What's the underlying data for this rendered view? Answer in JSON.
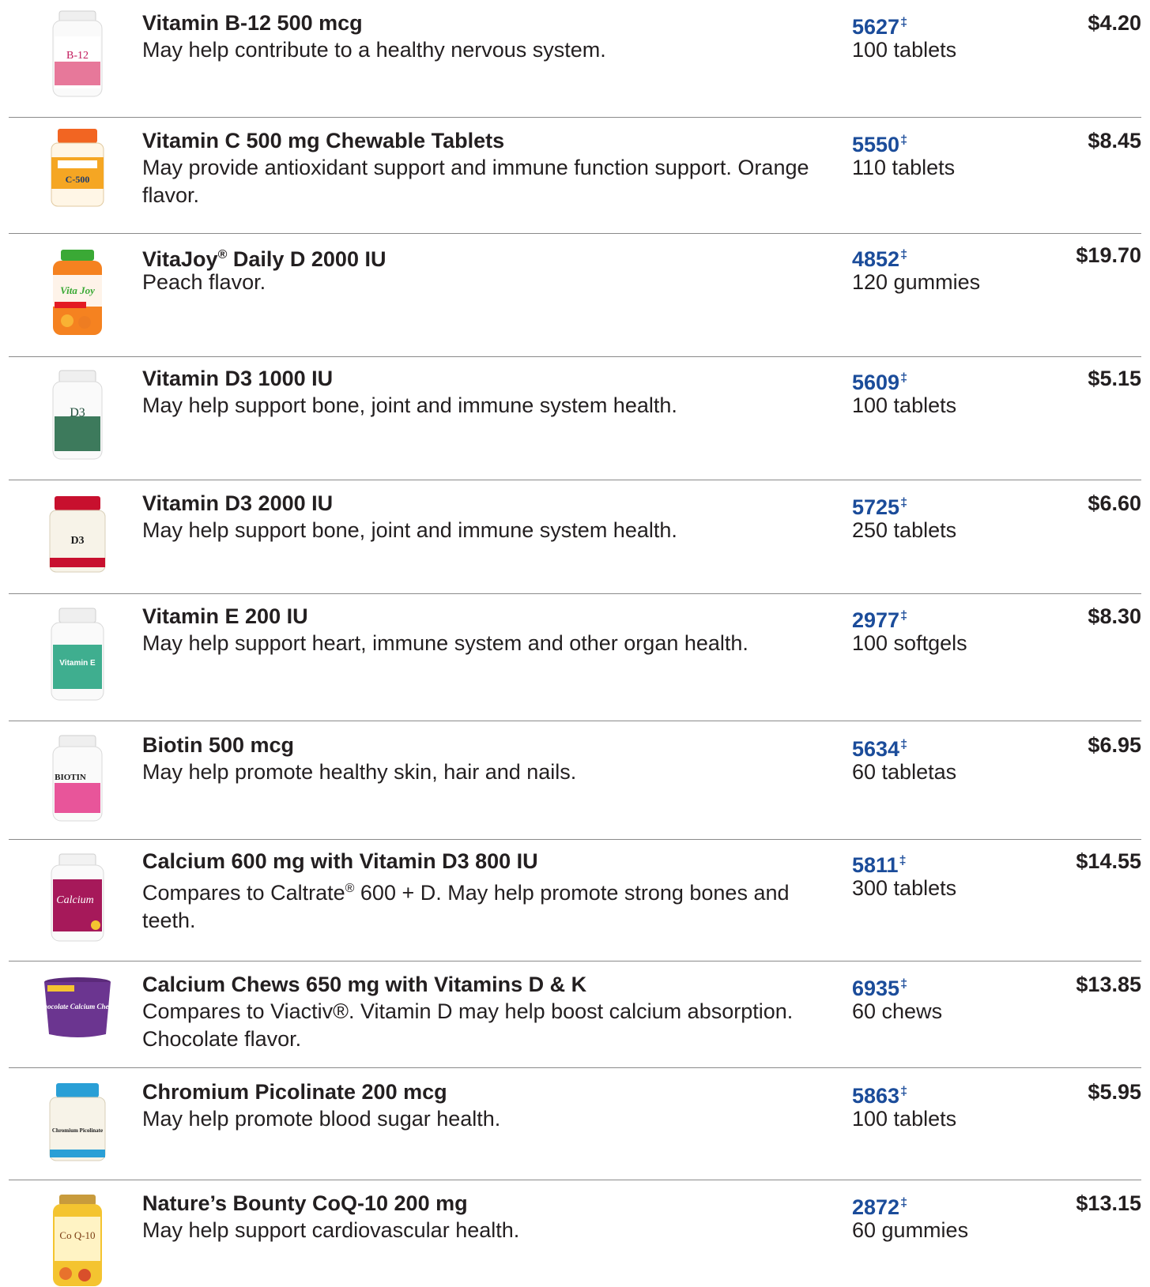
{
  "products": [
    {
      "name": "Vitamin B-12 500 mcg",
      "description": "May help contribute to a healthy nervous system.",
      "item_number": "5627",
      "item_mark": "‡",
      "count": "100 tablets",
      "price": "$4.20",
      "image": "vitamin-b12-bottle",
      "label_text": "B-12",
      "cap_color": "#f2f2f2",
      "label_color": "#e7789a"
    },
    {
      "name": "Vitamin C 500 mg Chewable Tablets",
      "description": "May provide antioxidant support and immune function support. Orange flavor.",
      "item_number": "5550",
      "item_mark": "‡",
      "count": "110 tablets",
      "price": "$8.45",
      "image": "vitamin-c-bottle",
      "label_text": "C-500",
      "cap_color": "#f26522",
      "label_color": "#f5a623"
    },
    {
      "name": "VitaJoy",
      "name_mark": "®",
      "name_suffix": " Daily D 2000 IU",
      "description": "Peach flavor.",
      "item_number": "4852",
      "item_mark": "‡",
      "count": "120 gummies",
      "price": "$19.70",
      "image": "vitajoy-gummies-jar",
      "label_text": "Vita Joy",
      "cap_color": "#3aa935",
      "label_color": "#f58220"
    },
    {
      "name": "Vitamin D3 1000 IU",
      "description": "May help support bone, joint and immune system health.",
      "item_number": "5609",
      "item_mark": "‡",
      "count": "100 tablets",
      "price": "$5.15",
      "image": "vitamin-d3-1000-bottle",
      "label_text": "D3",
      "cap_color": "#f2f2f2",
      "label_color": "#3d7a5c"
    },
    {
      "name": "Vitamin D3 2000 IU",
      "description": "May help support bone, joint and immune system health.",
      "item_number": "5725",
      "item_mark": "‡",
      "count": "250 tablets",
      "price": "$6.60",
      "image": "vitamin-d3-2000-bottle",
      "label_text": "D3",
      "cap_color": "#c8102e",
      "label_color": "#f7f3e8"
    },
    {
      "name": "Vitamin E 200 IU",
      "description": "May help support heart, immune system and other organ health.",
      "item_number": "2977",
      "item_mark": "‡",
      "count": "100 softgels",
      "price": "$8.30",
      "image": "vitamin-e-bottle",
      "label_text": "Vitamin E",
      "cap_color": "#f2f2f2",
      "label_color": "#3fae8f"
    },
    {
      "name": "Biotin 500 mcg",
      "description": "May help promote healthy skin, hair and nails.",
      "item_number": "5634",
      "item_mark": "‡",
      "count": "60 tabletas",
      "price": "$6.95",
      "image": "biotin-bottle",
      "label_text": "BIOTIN",
      "cap_color": "#f2f2f2",
      "label_color": "#e8559a"
    },
    {
      "name": "Calcium 600 mg with Vitamin D3 800 IU",
      "description_pre": "Compares to Caltrate",
      "description_mark": "®",
      "description_post": " 600 + D. May help promote strong bones and teeth.",
      "item_number": "5811",
      "item_mark": "‡",
      "count": "300 tablets",
      "price": "$14.55",
      "image": "calcium-bottle",
      "label_text": "Calcium",
      "cap_color": "#f2f2f2",
      "label_color": "#a6195a"
    },
    {
      "name": "Calcium Chews 650 mg with Vitamins D & K",
      "description": "Compares to Viactiv®. Vitamin D may help boost calcium absorption. Chocolate flavor.",
      "item_number": "6935",
      "item_mark": "‡",
      "count": "60 chews",
      "price": "$13.85",
      "image": "calcium-chews-tub",
      "label_text": "Chocolate Calcium Chews",
      "cap_color": "#5b2a7a",
      "label_color": "#6b3590"
    },
    {
      "name": "Chromium Picolinate 200 mcg",
      "description": "May help promote blood sugar health.",
      "item_number": "5863",
      "item_mark": "‡",
      "count": "100 tablets",
      "price": "$5.95",
      "image": "chromium-bottle",
      "label_text": "Chromium Picolinate",
      "cap_color": "#2a9fd6",
      "label_color": "#f7f3e8"
    },
    {
      "name": "Nature’s Bounty CoQ-10 200 mg",
      "description": "May help support cardiovascular health.",
      "item_number": "2872",
      "item_mark": "‡",
      "count": "60 gummies",
      "price": "$13.15",
      "image": "coq10-gummies-jar",
      "label_text": "Co Q-10",
      "cap_color": "#c89b3c",
      "label_color": "#f4c430"
    }
  ]
}
